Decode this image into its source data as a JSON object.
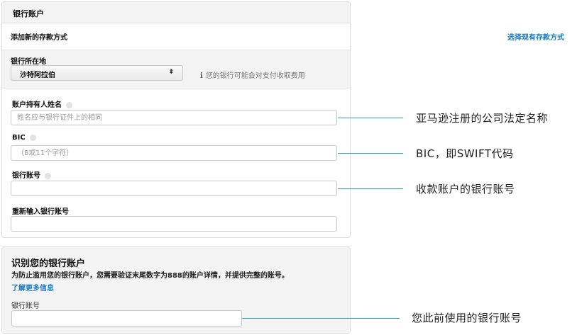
{
  "bank_account": {
    "header_title": "银行账户",
    "add_new_label": "添加新的存款方式",
    "choose_existing_link": "选择现有存款方式",
    "country": {
      "label": "银行所在地",
      "selected": "沙特阿拉伯",
      "arrows_glyph": "⬍",
      "info_glyph": "i",
      "info_text": "您的银行可能会对支付收取费用"
    },
    "fields": [
      {
        "label": "账户持有人姓名",
        "placeholder": "姓名应与银行证件上的相同",
        "has_help": true
      },
      {
        "label": "BIC",
        "placeholder": "（8或11个字符）",
        "has_help": true
      },
      {
        "label": "银行账号",
        "placeholder": "",
        "has_help": true
      },
      {
        "label": "重新输入银行账号",
        "placeholder": "",
        "has_help": false
      }
    ]
  },
  "identify": {
    "title": "识别您的银行账户",
    "description": "为防止滥用您的银行账户，您需要验证末尾数字为888的账户详情，并提供完整的账号。",
    "learn_more": "了解更多信息",
    "prev_account_label": "银行账号"
  },
  "annotations": {
    "account_holder": "亚马逊注册的公司法定名称",
    "bic": "BIC，即SWIFT代码",
    "account_number": "收款账户的银行账号",
    "previous_account": "您此前使用的银行账号"
  },
  "colors": {
    "link": "#1a7bc4",
    "callout_line": "#2e9fd0"
  }
}
